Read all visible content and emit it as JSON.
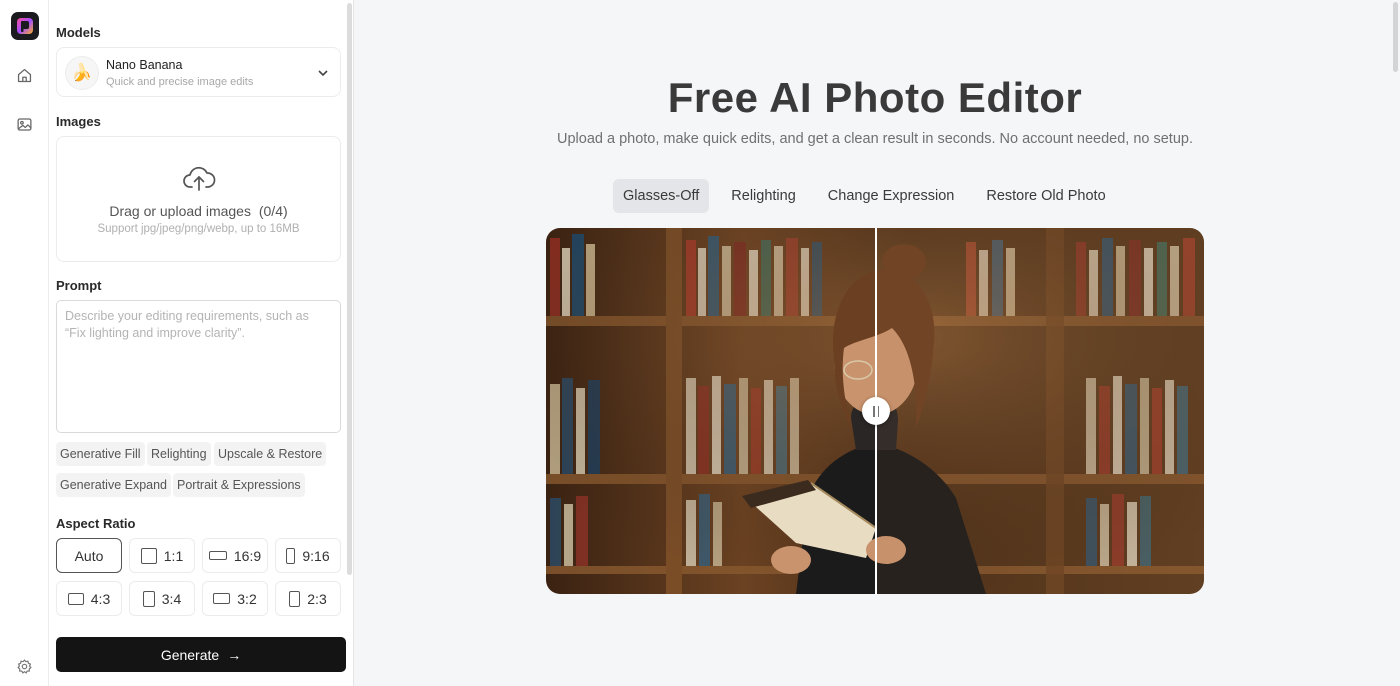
{
  "sidebar": {
    "icons": [
      "app-logo",
      "home-icon",
      "image-icon",
      "gear-icon"
    ]
  },
  "panel": {
    "models_title": "Models",
    "model": {
      "emoji": "🍌",
      "name": "Nano Banana",
      "description": "Quick and precise image edits"
    },
    "images_title": "Images",
    "upload": {
      "text": "Drag or upload images",
      "count": "(0/4)",
      "support": "Support jpg/jpeg/png/webp, up to 16MB"
    },
    "prompt_title": "Prompt",
    "prompt_placeholder": "Describe your editing requirements, such as “Fix lighting and improve clarity”.",
    "prompt_value": "",
    "chips": [
      "Generative Fill",
      "Relighting",
      "Upscale & Restore",
      "Generative Expand",
      "Portrait & Expressions"
    ],
    "aspect_title": "Aspect Ratio",
    "ratios": [
      "Auto",
      "1:1",
      "16:9",
      "9:16",
      "4:3",
      "3:4",
      "3:2",
      "2:3"
    ],
    "selected_ratio": "Auto",
    "generate_label": "Generate",
    "generate_arrow": "→"
  },
  "main": {
    "title": "Free AI Photo Editor",
    "subtitle": "Upload a photo, make quick edits, and get a clean result in seconds. No account needed, no setup.",
    "tabs": [
      "Glasses-Off",
      "Relighting",
      "Change Expression",
      "Restore Old Photo"
    ],
    "active_tab": "Glasses-Off",
    "comparison_split": 0.5
  },
  "colors": {
    "accent_dark": "#141414",
    "background": "#f5f6f8"
  }
}
